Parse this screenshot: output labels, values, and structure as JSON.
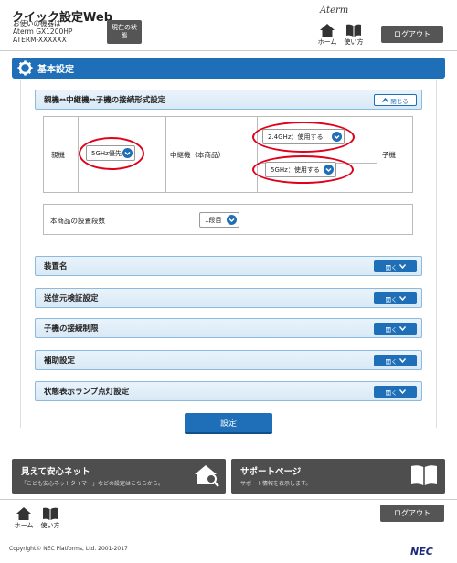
{
  "header": {
    "app_title": "クイック設定Web",
    "device_label": "お使いの機器は",
    "device_model": "Aterm GX1200HP",
    "device_ssid": "ATERM-XXXXXX",
    "status_button": "現在の状態",
    "home_label": "ホーム",
    "help_label": "使い方",
    "brand": "Aterm",
    "logout_label": "ログアウト"
  },
  "section": {
    "title": "基本設定"
  },
  "connection": {
    "title": "親機⇔中継機⇔子機の接続形式設定",
    "close_label": "閉じる",
    "parent_label": "親機",
    "parent_value": "5GHz優先",
    "repeater_label": "中継機（本商品）",
    "repeater_24_value": "2.4GHz：使用する",
    "repeater_5_value": "5GHz：使用する",
    "child_label": "子機"
  },
  "stage": {
    "label": "本商品の設置段数",
    "value": "1段目"
  },
  "accordions": [
    {
      "title": "装置名",
      "open_label": "開く"
    },
    {
      "title": "送信元検証設定",
      "open_label": "開く"
    },
    {
      "title": "子機の接続制限",
      "open_label": "開く"
    },
    {
      "title": "補助設定",
      "open_label": "開く"
    },
    {
      "title": "状態表示ランプ点灯設定",
      "open_label": "開く"
    }
  ],
  "submit_label": "設定",
  "banners": {
    "left_title": "見えて安心ネット",
    "left_sub": "「こども安心ネットタイマー」などの設定はこちらから。",
    "right_title": "サポートページ",
    "right_sub": "サポート情報を表示します。"
  },
  "footer": {
    "home_label": "ホーム",
    "help_label": "使い方",
    "logout_label": "ログアウト",
    "copyright": "Copyright© NEC Platforms, Ltd. 2001-2017",
    "logo": "NEC"
  },
  "colors": {
    "accent": "#1f6fb8",
    "highlight_ring": "#e0001b",
    "dark_button": "#555555"
  }
}
